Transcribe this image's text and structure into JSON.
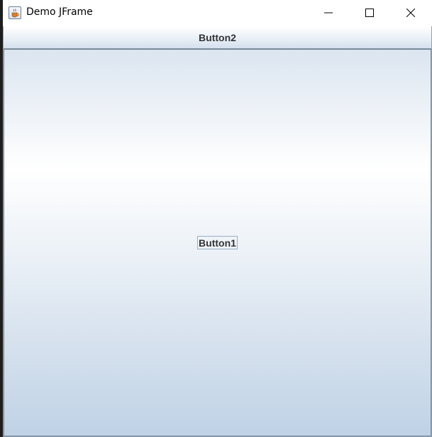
{
  "window": {
    "title": "Demo JFrame",
    "icon": "java-cup-icon",
    "controls": [
      "minimize-icon",
      "maximize-icon",
      "close-icon"
    ]
  },
  "content": {
    "north_button_label": "Button2",
    "center_button_label": "Button1",
    "focused_button": "Button1"
  },
  "colors": {
    "text": "#333333",
    "border": "#7a8a99",
    "gradient_top": "#dbe5f0",
    "gradient_bottom": "#bfd2e6"
  }
}
